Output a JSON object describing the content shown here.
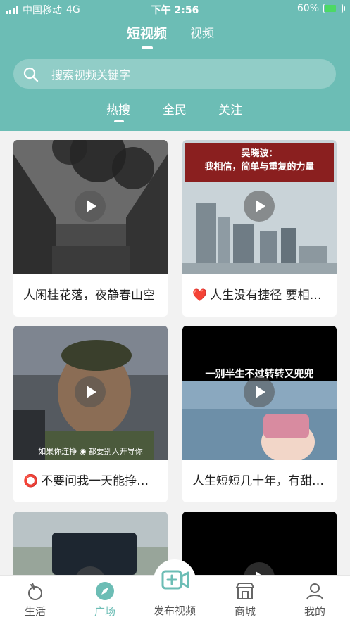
{
  "status": {
    "carrier": "中国移动",
    "network": "4G",
    "time": "下午 2:56",
    "battery": "60%"
  },
  "top_tabs": [
    {
      "label": "短视频"
    },
    {
      "label": "视频"
    }
  ],
  "search": {
    "placeholder": "搜索视频关键字"
  },
  "sub_tabs": [
    {
      "label": "热搜"
    },
    {
      "label": "全民"
    },
    {
      "label": "关注"
    }
  ],
  "cards": [
    {
      "title": "人闲桂花落，夜静春山空"
    },
    {
      "title": "人生没有捷径 要相信简单与重复的力量",
      "emoji": "❤️",
      "overlay_author": "吴晓波：",
      "overlay_text": "我相信，简单与重复的力量"
    },
    {
      "title": "不要问我一天能挣多少钱",
      "emoji": "⭕",
      "subtitle": "如果你连挣 ◉ 都要别人开导你"
    },
    {
      "title": "人生短短几十年，有甜也有苦",
      "overlay_text": "一别半生不过转转又兜兜"
    },
    {
      "title": ""
    },
    {
      "title": ""
    }
  ],
  "nav": [
    {
      "label": "生活",
      "icon": "life-icon"
    },
    {
      "label": "广场",
      "icon": "compass-icon"
    },
    {
      "label": "发布视频",
      "icon": "publish-video-icon"
    },
    {
      "label": "商城",
      "icon": "shop-icon"
    },
    {
      "label": "我的",
      "icon": "profile-icon"
    }
  ],
  "colors": {
    "accent": "#6cbdb5"
  }
}
